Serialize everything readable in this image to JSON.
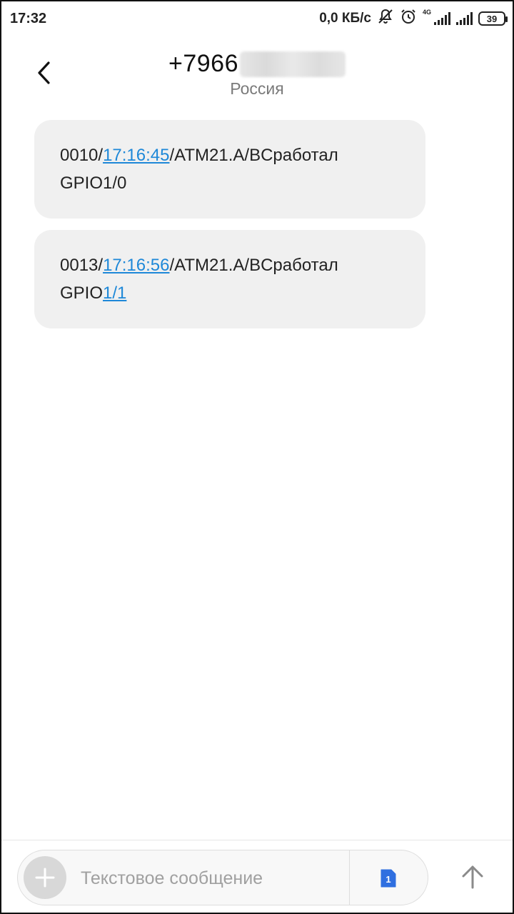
{
  "status_bar": {
    "time": "17:32",
    "net_speed": "0,0 КБ/с",
    "network_type": "4G",
    "battery": "39",
    "icons": [
      "mute-icon",
      "alarm-icon",
      "signal-icon",
      "signal-icon"
    ]
  },
  "header": {
    "phone_visible": "+7966",
    "subtitle": "Россия",
    "back_icon": "back-arrow-icon"
  },
  "messages": [
    {
      "prefix": "0010/",
      "link_time": "17:16:45",
      "middle": "/ATM21.A/BCработал",
      "line2_prefix": "GPIO1/0",
      "line2_link": ""
    },
    {
      "prefix": "0013/",
      "link_time": "17:16:56",
      "middle": "/ATM21.A/BCработал",
      "line2_prefix": "GPIO",
      "line2_link": "1/1"
    }
  ],
  "composer": {
    "placeholder": "Текстовое сообщение",
    "sim_label": "1",
    "add_icon": "plus-icon",
    "send_icon": "send-arrow-icon"
  },
  "colors": {
    "link": "#1e88d8",
    "bubble": "#f0f0f0",
    "sim_badge": "#2f6fe0"
  }
}
